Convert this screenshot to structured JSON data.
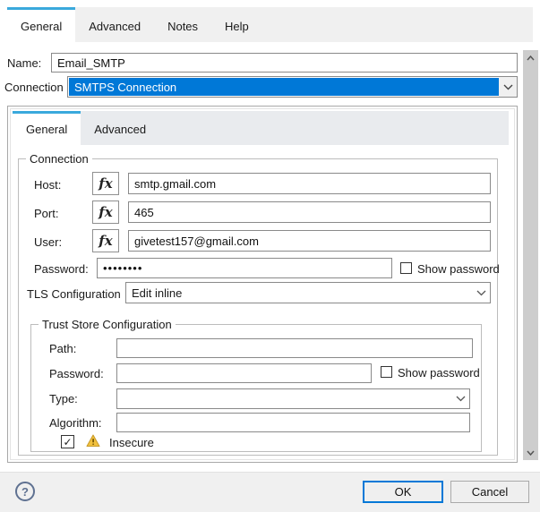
{
  "outer_tabs": {
    "general": "General",
    "advanced": "Advanced",
    "notes": "Notes",
    "help": "Help"
  },
  "header_fields": {
    "name": {
      "label": "Name:",
      "value": "Email_SMTP"
    },
    "connection": {
      "label": "Connection",
      "selected_value": "SMTPS Connection"
    }
  },
  "inner_tabs": {
    "general": "General",
    "advanced": "Advanced"
  },
  "connection_group": {
    "legend": "Connection",
    "host": {
      "label": "Host:",
      "value": "smtp.gmail.com"
    },
    "port": {
      "label": "Port:",
      "value": "465"
    },
    "user": {
      "label": "User:",
      "value": "givetest157@gmail.com"
    },
    "password": {
      "label": "Password:",
      "value": "••••••••",
      "show_password_label": "Show password",
      "show_password_checked": false
    },
    "tls": {
      "label": "TLS Configuration",
      "selected_value": "Edit inline"
    }
  },
  "trust_store_group": {
    "legend": "Trust Store Configuration",
    "path": {
      "label": "Path:",
      "value": ""
    },
    "password": {
      "label": "Password:",
      "value": "",
      "show_password_label": "Show password",
      "show_password_checked": false
    },
    "type": {
      "label": "Type:",
      "selected_value": ""
    },
    "algorithm": {
      "label": "Algorithm:",
      "value": ""
    },
    "insecure": {
      "label": "Insecure",
      "checked": true
    }
  },
  "footer": {
    "ok_label": "OK",
    "cancel_label": "Cancel"
  },
  "glyphs": {
    "fx": "fx",
    "check": "✓",
    "question": "?"
  },
  "colors": {
    "tab_accent": "#3aa9dc",
    "selection_blue": "#0078d7",
    "ok_border_blue": "#0078d7",
    "warning_yellow": "#f2c13d",
    "help_icon_blue": "#5f7191"
  }
}
